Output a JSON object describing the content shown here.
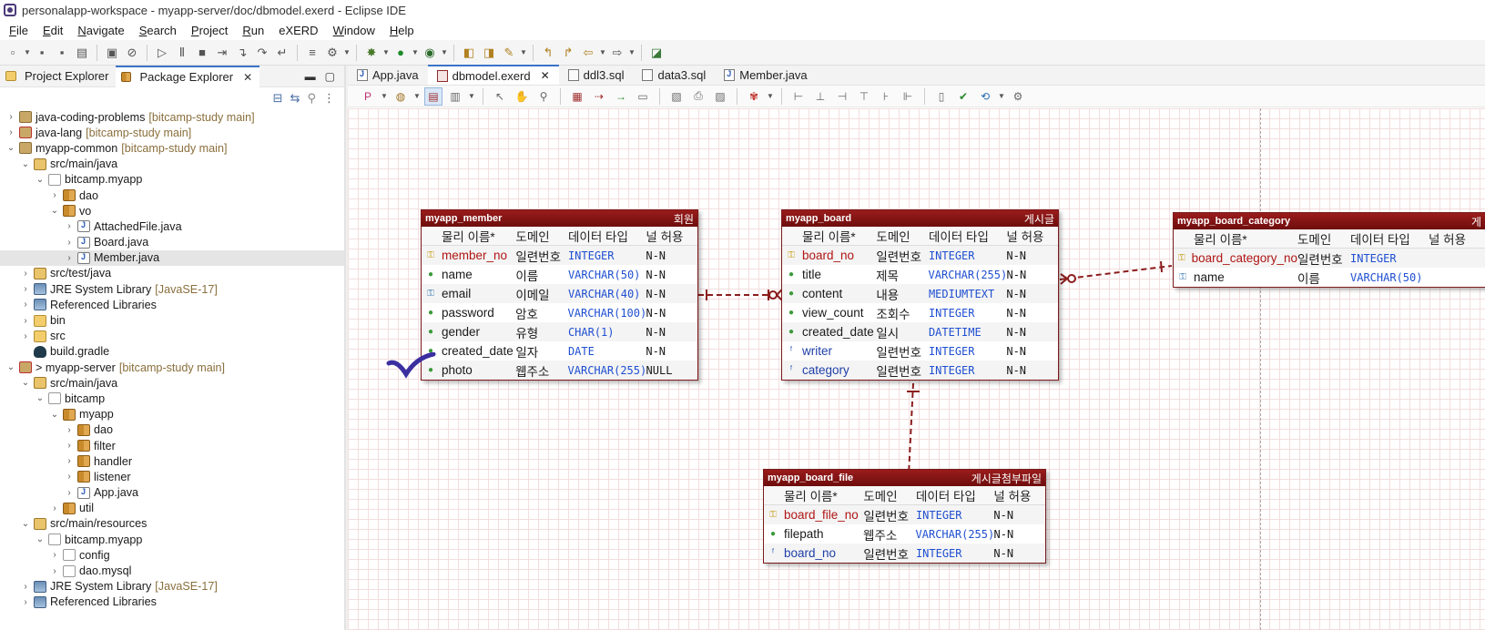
{
  "window": {
    "title": "personalapp-workspace - myapp-server/doc/dbmodel.exerd - Eclipse IDE"
  },
  "menu": [
    {
      "u": "F",
      "rest": "ile"
    },
    {
      "u": "E",
      "rest": "dit"
    },
    {
      "u": "N",
      "rest": "avigate"
    },
    {
      "u": "S",
      "rest": "earch"
    },
    {
      "u": "P",
      "rest": "roject"
    },
    {
      "u": "R",
      "rest": "un"
    },
    {
      "u": "",
      "rest": "eXERD"
    },
    {
      "u": "W",
      "rest": "indow"
    },
    {
      "u": "H",
      "rest": "elp"
    }
  ],
  "left": {
    "tabs": [
      {
        "label": "Project Explorer",
        "active": false
      },
      {
        "label": "Package Explorer",
        "active": true
      }
    ],
    "tree": [
      {
        "depth": 0,
        "tw": ">",
        "icon": "project",
        "label": "java-coding-problems",
        "repo": "[bitcamp-study main]"
      },
      {
        "depth": 0,
        "tw": ">",
        "icon": "project-git",
        "label": "java-lang",
        "repo": "[bitcamp-study main]"
      },
      {
        "depth": 0,
        "tw": "v",
        "icon": "project",
        "label": "myapp-common",
        "repo": "[bitcamp-study main]"
      },
      {
        "depth": 1,
        "tw": "v",
        "icon": "srcfolder",
        "label": "src/main/java",
        "repo": ""
      },
      {
        "depth": 2,
        "tw": "v",
        "icon": "pkg-empty",
        "label": "bitcamp.myapp",
        "repo": ""
      },
      {
        "depth": 3,
        "tw": ">",
        "icon": "package",
        "label": "dao",
        "repo": ""
      },
      {
        "depth": 3,
        "tw": "v",
        "icon": "package",
        "label": "vo",
        "repo": ""
      },
      {
        "depth": 4,
        "tw": ">",
        "icon": "java",
        "label": "AttachedFile.java",
        "repo": ""
      },
      {
        "depth": 4,
        "tw": ">",
        "icon": "java",
        "label": "Board.java",
        "repo": ""
      },
      {
        "depth": 4,
        "tw": ">",
        "icon": "java",
        "label": "Member.java",
        "repo": "",
        "selected": true
      },
      {
        "depth": 1,
        "tw": ">",
        "icon": "srcfolder",
        "label": "src/test/java",
        "repo": ""
      },
      {
        "depth": 1,
        "tw": ">",
        "icon": "lib",
        "label": "JRE System Library",
        "repo": "[JavaSE-17]"
      },
      {
        "depth": 1,
        "tw": ">",
        "icon": "lib",
        "label": "Referenced Libraries",
        "repo": ""
      },
      {
        "depth": 1,
        "tw": ">",
        "icon": "folder",
        "label": "bin",
        "repo": ""
      },
      {
        "depth": 1,
        "tw": ">",
        "icon": "folder",
        "label": "src",
        "repo": ""
      },
      {
        "depth": 1,
        "tw": "",
        "icon": "gradle",
        "label": "build.gradle",
        "repo": ""
      },
      {
        "depth": 0,
        "tw": "v",
        "icon": "project-git",
        "label": "> myapp-server",
        "repo": "[bitcamp-study main]"
      },
      {
        "depth": 1,
        "tw": "v",
        "icon": "srcfolder",
        "label": "src/main/java",
        "repo": ""
      },
      {
        "depth": 2,
        "tw": "v",
        "icon": "pkg-empty",
        "label": "bitcamp",
        "repo": ""
      },
      {
        "depth": 3,
        "tw": "v",
        "icon": "package",
        "label": "myapp",
        "repo": ""
      },
      {
        "depth": 4,
        "tw": ">",
        "icon": "package",
        "label": "dao",
        "repo": ""
      },
      {
        "depth": 4,
        "tw": ">",
        "icon": "package",
        "label": "filter",
        "repo": ""
      },
      {
        "depth": 4,
        "tw": ">",
        "icon": "package",
        "label": "handler",
        "repo": ""
      },
      {
        "depth": 4,
        "tw": ">",
        "icon": "package",
        "label": "listener",
        "repo": ""
      },
      {
        "depth": 4,
        "tw": ">",
        "icon": "java",
        "label": "App.java",
        "repo": ""
      },
      {
        "depth": 3,
        "tw": ">",
        "icon": "package",
        "label": "util",
        "repo": ""
      },
      {
        "depth": 1,
        "tw": "v",
        "icon": "srcfolder",
        "label": "src/main/resources",
        "repo": ""
      },
      {
        "depth": 2,
        "tw": "v",
        "icon": "pkg-empty",
        "label": "bitcamp.myapp",
        "repo": ""
      },
      {
        "depth": 3,
        "tw": ">",
        "icon": "pkg-empty",
        "label": "config",
        "repo": ""
      },
      {
        "depth": 3,
        "tw": ">",
        "icon": "pkg-empty",
        "label": "dao.mysql",
        "repo": ""
      },
      {
        "depth": 1,
        "tw": ">",
        "icon": "lib",
        "label": "JRE System Library",
        "repo": "[JavaSE-17]"
      },
      {
        "depth": 1,
        "tw": ">",
        "icon": "lib",
        "label": "Referenced Libraries",
        "repo": ""
      }
    ]
  },
  "editor": {
    "tabs": [
      {
        "label": "App.java",
        "icon": "java",
        "active": false,
        "close": false
      },
      {
        "label": "dbmodel.exerd",
        "icon": "erd",
        "active": true,
        "close": true
      },
      {
        "label": "ddl3.sql",
        "icon": "sql",
        "active": false,
        "close": false
      },
      {
        "label": "data3.sql",
        "icon": "sql",
        "active": false,
        "close": false
      },
      {
        "label": "Member.java",
        "icon": "java",
        "active": false,
        "close": false
      }
    ]
  },
  "erd": {
    "col_headers": {
      "physical": "물리 이름*",
      "domain": "도메인",
      "type": "데이터 타입",
      "null": "널 허용"
    },
    "entities": [
      {
        "id": "member",
        "name": "myapp_member",
        "logical": "회원",
        "columns": [
          {
            "key": "pk",
            "name": "member_no",
            "domain": "일련번호",
            "type": "INTEGER",
            "null": "N-N"
          },
          {
            "key": "dot",
            "name": "name",
            "domain": "이름",
            "type": "VARCHAR(50)",
            "null": "N-N"
          },
          {
            "key": "key",
            "name": "email",
            "domain": "이메일",
            "type": "VARCHAR(40)",
            "null": "N-N"
          },
          {
            "key": "dot",
            "name": "password",
            "domain": "암호",
            "type": "VARCHAR(100)",
            "null": "N-N"
          },
          {
            "key": "dot",
            "name": "gender",
            "domain": "유형",
            "type": "CHAR(1)",
            "null": "N-N"
          },
          {
            "key": "dot",
            "name": "created_date",
            "domain": "일자",
            "type": "DATE",
            "null": "N-N"
          },
          {
            "key": "dot",
            "name": "photo",
            "domain": "웹주소",
            "type": "VARCHAR(255)",
            "null": "NULL"
          }
        ]
      },
      {
        "id": "board",
        "name": "myapp_board",
        "logical": "게시글",
        "columns": [
          {
            "key": "pk",
            "name": "board_no",
            "domain": "일련번호",
            "type": "INTEGER",
            "null": "N-N"
          },
          {
            "key": "dot",
            "name": "title",
            "domain": "제목",
            "type": "VARCHAR(255)",
            "null": "N-N"
          },
          {
            "key": "dot",
            "name": "content",
            "domain": "내용",
            "type": "MEDIUMTEXT",
            "null": "N-N"
          },
          {
            "key": "dot",
            "name": "view_count",
            "domain": "조회수",
            "type": "INTEGER",
            "null": "N-N"
          },
          {
            "key": "dot",
            "name": "created_date",
            "domain": "일시",
            "type": "DATETIME",
            "null": "N-N"
          },
          {
            "key": "fk",
            "name": "writer",
            "domain": "일련번호",
            "type": "INTEGER",
            "null": "N-N"
          },
          {
            "key": "fk",
            "name": "category",
            "domain": "일련번호",
            "type": "INTEGER",
            "null": "N-N"
          }
        ]
      },
      {
        "id": "category",
        "name": "myapp_board_category",
        "logical": "게",
        "columns": [
          {
            "key": "pk",
            "name": "board_category_no",
            "domain": "일련번호",
            "type": "INTEGER",
            "null": ""
          },
          {
            "key": "key",
            "name": "name",
            "domain": "이름",
            "type": "VARCHAR(50)",
            "null": ""
          }
        ]
      },
      {
        "id": "file",
        "name": "myapp_board_file",
        "logical": "게시글첨부파일",
        "columns": [
          {
            "key": "pk",
            "name": "board_file_no",
            "domain": "일련번호",
            "type": "INTEGER",
            "null": "N-N"
          },
          {
            "key": "dot",
            "name": "filepath",
            "domain": "웹주소",
            "type": "VARCHAR(255)",
            "null": "N-N"
          },
          {
            "key": "fk",
            "name": "board_no",
            "domain": "일련번호",
            "type": "INTEGER",
            "null": "N-N"
          }
        ]
      }
    ]
  }
}
